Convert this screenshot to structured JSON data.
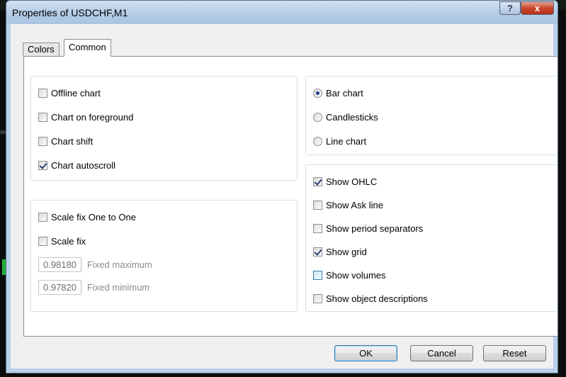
{
  "window": {
    "title": "Properties of USDCHF,M1"
  },
  "title_buttons": {
    "help": "?",
    "close": "x"
  },
  "tabs": [
    {
      "label": "Colors"
    },
    {
      "label": "Common",
      "selected": true
    }
  ],
  "chart_options": [
    {
      "label": "Offline chart",
      "checked": false
    },
    {
      "label": "Chart on foreground",
      "checked": false
    },
    {
      "label": "Chart shift",
      "checked": false
    },
    {
      "label": "Chart autoscroll",
      "checked": true
    }
  ],
  "scale_options": [
    {
      "label": "Scale fix One to One",
      "checked": false
    },
    {
      "label": "Scale fix",
      "checked": false
    }
  ],
  "fixed_values": [
    {
      "value": "0.98180",
      "label": "Fixed maximum"
    },
    {
      "value": "0.97820",
      "label": "Fixed minimum"
    }
  ],
  "chart_types": [
    {
      "label": "Bar chart",
      "selected": true
    },
    {
      "label": "Candlesticks",
      "selected": false
    },
    {
      "label": "Line chart",
      "selected": false
    }
  ],
  "show_options": [
    {
      "label": "Show OHLC",
      "checked": true
    },
    {
      "label": "Show Ask line",
      "checked": false
    },
    {
      "label": "Show period separators",
      "checked": false
    },
    {
      "label": "Show grid",
      "checked": true
    },
    {
      "label": "Show volumes",
      "checked": false
    },
    {
      "label": "Show object descriptions",
      "checked": false
    }
  ],
  "buttons": {
    "ok": "OK",
    "cancel": "Cancel",
    "reset": "Reset"
  }
}
